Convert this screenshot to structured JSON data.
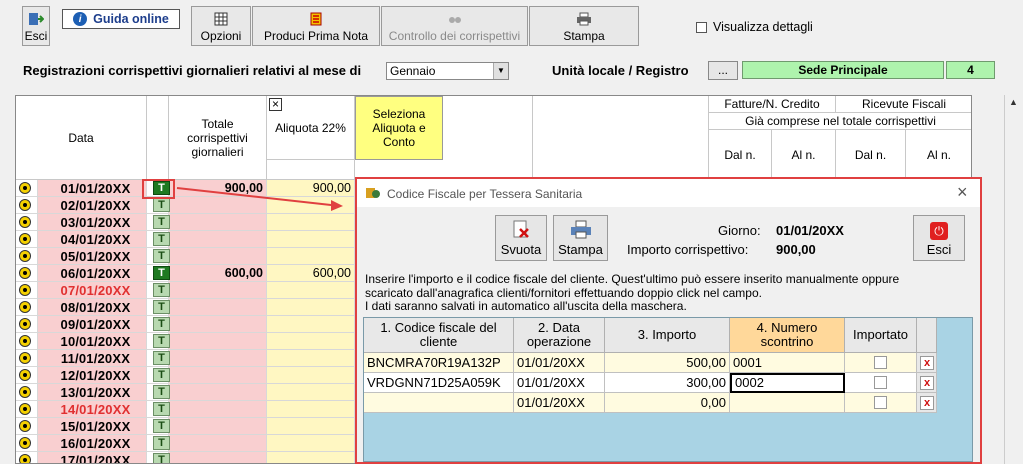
{
  "toolbar": {
    "esci": "Esci",
    "guida": "Guida online",
    "opzioni": "Opzioni",
    "produci": "Produci Prima Nota",
    "controllo": "Controllo dei corrispettivi",
    "stampa": "Stampa",
    "visualizza": "Visualizza dettagli"
  },
  "filter": {
    "label": "Registrazioni corrispettivi giornalieri relativi al mese di",
    "month": "Gennaio",
    "unita_label": "Unità locale / Registro",
    "ellipsis": "...",
    "sede": "Sede Principale",
    "registro": "4"
  },
  "grid": {
    "col_data": "Data",
    "col_totale": "Totale corrispettivi giornalieri",
    "col_aliquota": "Aliquota 22%",
    "col_seleziona": "Seleziona Aliquota e Conto",
    "col_fatture": "Fatture/N. Credito",
    "col_ricevute": "Ricevute Fiscali",
    "col_gia": "Già comprese nel totale corrispettivi",
    "dal1": "Dal n.",
    "al1": "Al n.",
    "dal2": "Dal n.",
    "al2": "Al n.",
    "close_x": "×",
    "t": "T",
    "rows": [
      {
        "date": "01/01/20XX",
        "totale": "900,00",
        "aliquota": "900,00",
        "red": false,
        "active": true
      },
      {
        "date": "02/01/20XX",
        "totale": "",
        "aliquota": "",
        "red": false,
        "active": false
      },
      {
        "date": "03/01/20XX",
        "totale": "",
        "aliquota": "",
        "red": false,
        "active": false
      },
      {
        "date": "04/01/20XX",
        "totale": "",
        "aliquota": "",
        "red": false,
        "active": false
      },
      {
        "date": "05/01/20XX",
        "totale": "",
        "aliquota": "",
        "red": false,
        "active": false
      },
      {
        "date": "06/01/20XX",
        "totale": "600,00",
        "aliquota": "600,00",
        "red": false,
        "active": true
      },
      {
        "date": "07/01/20XX",
        "totale": "",
        "aliquota": "",
        "red": true,
        "active": false
      },
      {
        "date": "08/01/20XX",
        "totale": "",
        "aliquota": "",
        "red": false,
        "active": false
      },
      {
        "date": "09/01/20XX",
        "totale": "",
        "aliquota": "",
        "red": false,
        "active": false
      },
      {
        "date": "10/01/20XX",
        "totale": "",
        "aliquota": "",
        "red": false,
        "active": false
      },
      {
        "date": "11/01/20XX",
        "totale": "",
        "aliquota": "",
        "red": false,
        "active": false
      },
      {
        "date": "12/01/20XX",
        "totale": "",
        "aliquota": "",
        "red": false,
        "active": false
      },
      {
        "date": "13/01/20XX",
        "totale": "",
        "aliquota": "",
        "red": false,
        "active": false
      },
      {
        "date": "14/01/20XX",
        "totale": "",
        "aliquota": "",
        "red": true,
        "active": false
      },
      {
        "date": "15/01/20XX",
        "totale": "",
        "aliquota": "",
        "red": false,
        "active": false
      },
      {
        "date": "16/01/20XX",
        "totale": "",
        "aliquota": "",
        "red": false,
        "active": false
      },
      {
        "date": "17/01/20XX",
        "totale": "",
        "aliquota": "",
        "red": false,
        "active": false
      }
    ]
  },
  "dialog": {
    "title": "Codice Fiscale per Tessera Sanitaria",
    "close": "×",
    "svuota": "Svuota",
    "stampa": "Stampa",
    "esci": "Esci",
    "giorno_label": "Giorno:",
    "giorno_value": "01/01/20XX",
    "importo_label": "Importo corrispettivo:",
    "importo_value": "900,00",
    "info1": "Inserire l'importo e il codice fiscale del cliente. Quest'ultimo può essere inserito manualmente oppure",
    "info2": "scaricato dall'anagrafica clienti/fornitori effettuando doppio click nel campo.",
    "info3": "I dati saranno salvati in automatico all'uscita della maschera.",
    "headers": {
      "cf": "1. Codice fiscale del cliente",
      "data": "2. Data operazione",
      "importo": "3. Importo",
      "scontrino": "4. Numero scontrino",
      "importato": "Importato"
    },
    "rows": [
      {
        "cf": "BNCMRA70R19A132P",
        "data": "01/01/20XX",
        "importo": "500,00",
        "scontrino": "0001"
      },
      {
        "cf": "VRDGNN71D25A059K",
        "data": "01/01/20XX",
        "importo": "300,00",
        "scontrino": "0002"
      },
      {
        "cf": "",
        "data": "01/01/20XX",
        "importo": "0,00",
        "scontrino": ""
      }
    ],
    "x": "x"
  },
  "colors": {
    "accent_red": "#e04040",
    "green_badge": "#1f7a22",
    "pink": "#f9cfd0",
    "yellow": "#fff7c2"
  }
}
